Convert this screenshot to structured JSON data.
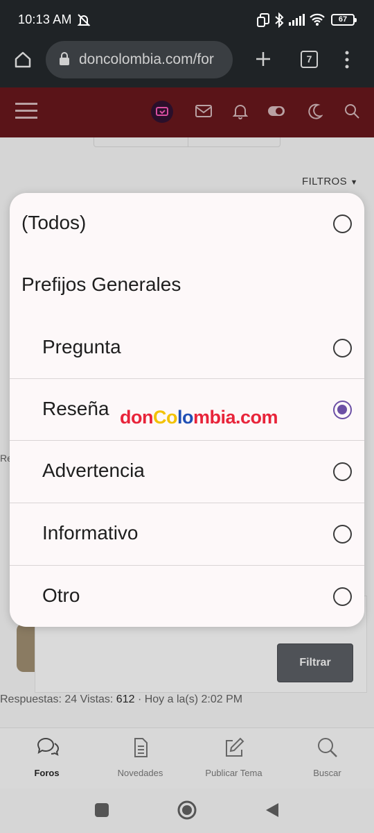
{
  "status_bar": {
    "time": "10:13 AM",
    "battery": "67"
  },
  "browser": {
    "url": "doncolombia.com/for",
    "tab_count": "7"
  },
  "page": {
    "filters_label": "FILTROS",
    "filter_button_label": "Filtrar",
    "thread_meta": {
      "replies_text": "Respuestas: 24 Vistas: ",
      "views": "612",
      "date_text": " · Hoy a la(s) 2:02 PM"
    },
    "edge_text": "Re"
  },
  "modal": {
    "options": [
      {
        "label": "(Todos)",
        "checked": false,
        "is_group": false
      },
      {
        "label": "Prefijos Generales",
        "is_group": true
      },
      {
        "label": "Pregunta",
        "checked": false,
        "is_group": false
      },
      {
        "label": "Reseña",
        "checked": true,
        "is_group": false
      },
      {
        "label": "Advertencia",
        "checked": false,
        "is_group": false
      },
      {
        "label": "Informativo",
        "checked": false,
        "is_group": false
      },
      {
        "label": "Otro",
        "checked": false,
        "is_group": false
      }
    ],
    "watermark": "donColombia.com",
    "accent_color": "#6b4fa5"
  },
  "bottom_nav": {
    "items": [
      {
        "label": "Foros",
        "icon": "forums-icon",
        "active": true
      },
      {
        "label": "Novedades",
        "icon": "document-icon",
        "active": false
      },
      {
        "label": "Publicar Tema",
        "icon": "edit-icon",
        "active": false
      },
      {
        "label": "Buscar",
        "icon": "search-icon",
        "active": false
      }
    ]
  },
  "colors": {
    "header_bg": "#5a1418",
    "status_bg": "#1f2326"
  }
}
